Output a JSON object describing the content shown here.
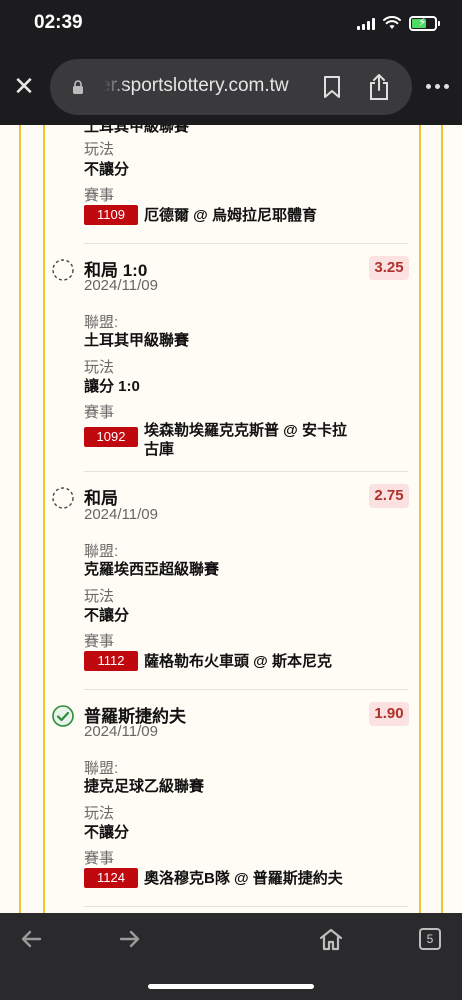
{
  "status_bar": {
    "time": "02:39",
    "battery_color": "#4cd964"
  },
  "browser": {
    "url": "er.sportslottery.com.tw",
    "close_icon": "close-icon",
    "toolbar_icons": [
      "back-arrow-icon",
      "forward-arrow-icon",
      "home-icon",
      "tabs-icon"
    ],
    "tab_count": "5"
  },
  "colors": {
    "tag_red": "#c0080f",
    "odds_bg": "#fbe2e0",
    "odds_text": "#b0302b",
    "border_yellow": "#f4c430",
    "win_green": "#2e8b3a"
  },
  "bets": [
    {
      "partial_top": "土耳其甲級聯賽",
      "play_label": "玩法",
      "play": "不讓分",
      "event_label": "賽事",
      "code": "1109",
      "match": "厄德爾 @ 烏姆拉尼耶體育"
    },
    {
      "selection": "和局 1:0",
      "date": "2024/11/09",
      "odds": "3.25",
      "result": "pending",
      "league_label": "聯盟:",
      "league": "土耳其甲級聯賽",
      "play_label": "玩法",
      "play": "讓分 1:0",
      "event_label": "賽事",
      "code": "1092",
      "match_line1": "埃森勒埃羅克克斯普 @ 安卡拉",
      "match_line2": "古庫"
    },
    {
      "selection": "和局",
      "date": "2024/11/09",
      "odds": "2.75",
      "result": "pending",
      "league_label": "聯盟:",
      "league": "克羅埃西亞超級聯賽",
      "play_label": "玩法",
      "play": "不讓分",
      "event_label": "賽事",
      "code": "1112",
      "match": "薩格勒布火車頭 @ 斯本尼克"
    },
    {
      "selection": "普羅斯捷約夫",
      "date": "2024/11/09",
      "odds": "1.90",
      "result": "won",
      "league_label": "聯盟:",
      "league": "捷克足球乙級聯賽",
      "play_label": "玩法",
      "play": "不讓分",
      "event_label": "賽事",
      "code": "1124",
      "match": "奧洛穆克B隊 @ 普羅斯捷約夫"
    }
  ]
}
